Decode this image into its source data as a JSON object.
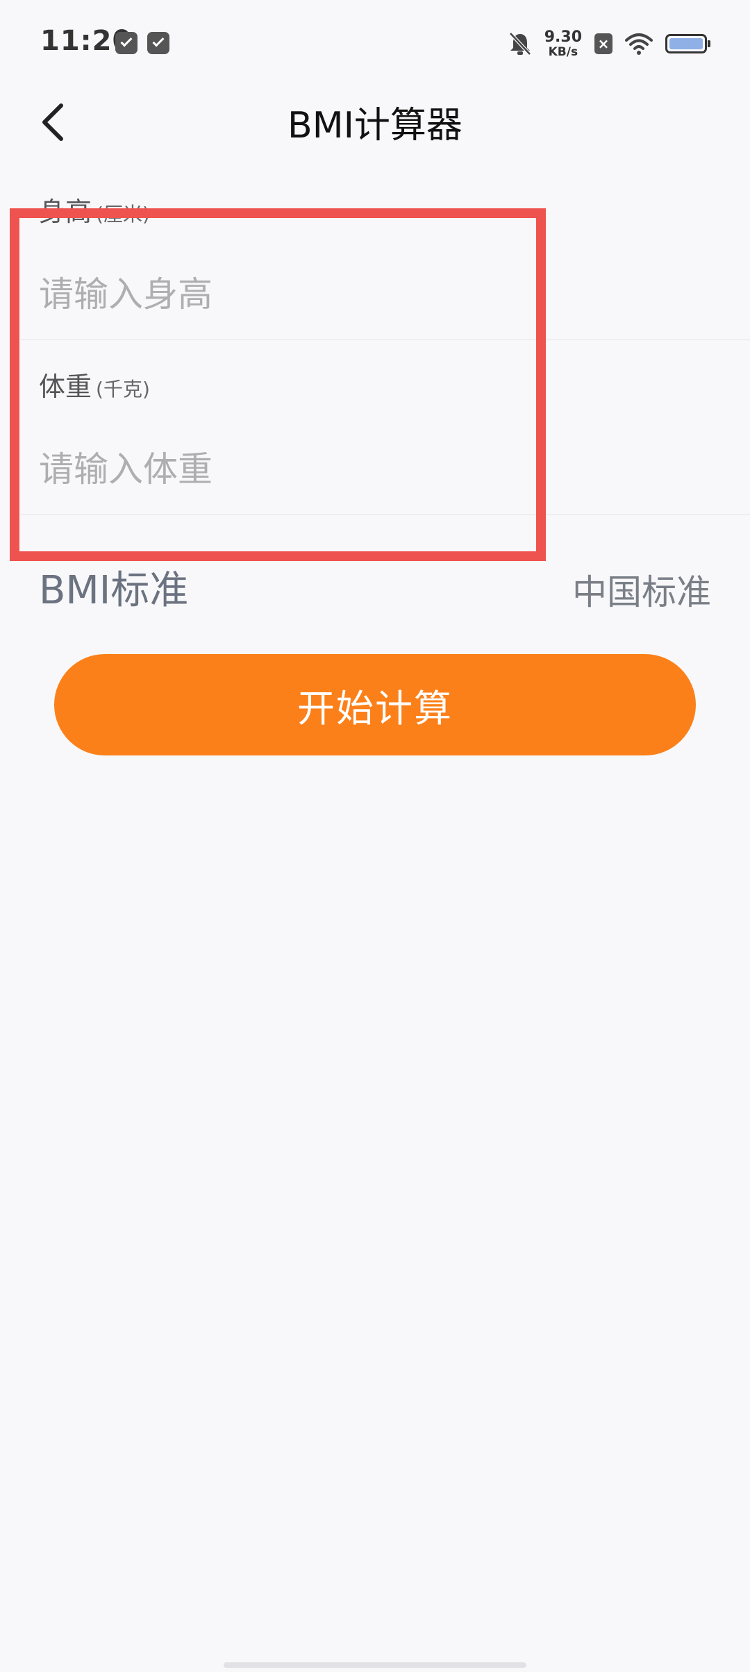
{
  "status_bar": {
    "time": "11:20",
    "net_speed_value": "9.30",
    "net_speed_unit": "KB/s",
    "sim_label": "×",
    "battery_level": 1.0,
    "icons": [
      "mail-icon",
      "calendar-icon",
      "bell-off-icon",
      "sim-x-icon",
      "wifi-icon",
      "battery-icon"
    ]
  },
  "header": {
    "title": "BMI计算器",
    "back_icon": "chevron-left-icon"
  },
  "form": {
    "height": {
      "label": "身高",
      "unit": "(厘米)",
      "value": "",
      "placeholder": "请输入身高"
    },
    "weight": {
      "label": "体重",
      "unit": "(千克)",
      "value": "",
      "placeholder": "请输入体重"
    }
  },
  "standard": {
    "label": "BMI标准",
    "value": "中国标准"
  },
  "calculate_button": {
    "label": "开始计算",
    "color": "#fc8019"
  },
  "colors": {
    "accent": "#fc8019",
    "highlight": "#ef5350",
    "background": "#f8f8fa"
  }
}
